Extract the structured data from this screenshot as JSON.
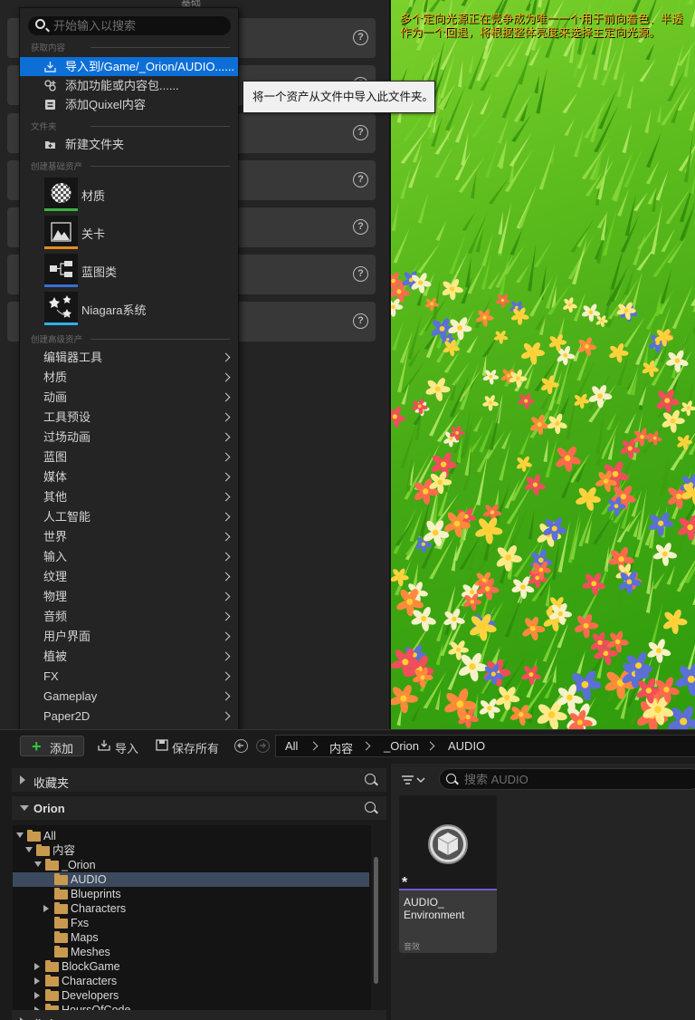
{
  "details_panel": {
    "top_title": "基础",
    "help_icon": "?"
  },
  "viewport": {
    "notice_line1": "多个定向光源正在竞争成为唯一一个用于前向着色、半透",
    "notice_line2": "作为一个回退，将根据整体亮度来选择主定向光源。"
  },
  "context_menu": {
    "search_placeholder": "开始输入以搜索",
    "section_get_content": "获取内容",
    "import_label": "导入到/Game/_Orion/AUDIO......",
    "add_feature_label": "添加功能或内容包......",
    "add_quixel_label": "添加Quixel内容",
    "section_folder": "文件夹",
    "new_folder_label": "新建文件夹",
    "section_basic_assets": "创建基础资产",
    "basic_assets": [
      {
        "label": "材质",
        "bar_color": "#3cb043"
      },
      {
        "label": "关卡",
        "bar_color": "#e58b1c"
      },
      {
        "label": "蓝图类",
        "bar_color": "#3a6fd6"
      },
      {
        "label": "Niagara系统",
        "bar_color": "#2fb1e8"
      }
    ],
    "section_advanced_assets": "创建高级资产",
    "advanced_items": [
      "编辑器工具",
      "材质",
      "动画",
      "工具预设",
      "过场动画",
      "蓝图",
      "媒体",
      "其他",
      "人工智能",
      "世界",
      "输入",
      "纹理",
      "物理",
      "音频",
      "用户界面",
      "植被",
      "FX",
      "Gameplay",
      "Paper2D"
    ]
  },
  "tooltip": {
    "text": "将一个资产从文件中导入此文件夹。"
  },
  "content_browser": {
    "add_label": "添加",
    "import_label": "导入",
    "save_all_label": "保存所有",
    "breadcrumbs": [
      "All",
      "内容",
      "_Orion",
      "AUDIO"
    ],
    "favorites_label": "收藏夹",
    "tree_root_label": "Orion",
    "tree": [
      {
        "label": "All",
        "depth": 0,
        "arrow": "down",
        "selected": false
      },
      {
        "label": "内容",
        "depth": 1,
        "arrow": "down",
        "selected": false
      },
      {
        "label": "_Orion",
        "depth": 2,
        "arrow": "down",
        "selected": false
      },
      {
        "label": "AUDIO",
        "depth": 3,
        "arrow": "",
        "selected": true
      },
      {
        "label": "Blueprints",
        "depth": 3,
        "arrow": "",
        "selected": false
      },
      {
        "label": "Characters",
        "depth": 3,
        "arrow": "right",
        "selected": false
      },
      {
        "label": "Fxs",
        "depth": 3,
        "arrow": "",
        "selected": false
      },
      {
        "label": "Maps",
        "depth": 3,
        "arrow": "",
        "selected": false
      },
      {
        "label": "Meshes",
        "depth": 3,
        "arrow": "",
        "selected": false
      },
      {
        "label": "BlockGame",
        "depth": 2,
        "arrow": "right",
        "selected": false
      },
      {
        "label": "Characters",
        "depth": 2,
        "arrow": "right",
        "selected": false
      },
      {
        "label": "Developers",
        "depth": 2,
        "arrow": "right",
        "selected": false
      },
      {
        "label": "HoursOfCode",
        "depth": 2,
        "arrow": "right",
        "selected": false
      }
    ],
    "collections_label": "集合",
    "search_placeholder": "搜索 AUDIO",
    "asset_tile": {
      "name_line1": "AUDIO_",
      "name_line2": "Environment",
      "type": "音效",
      "dirty_marker": "*"
    }
  }
}
